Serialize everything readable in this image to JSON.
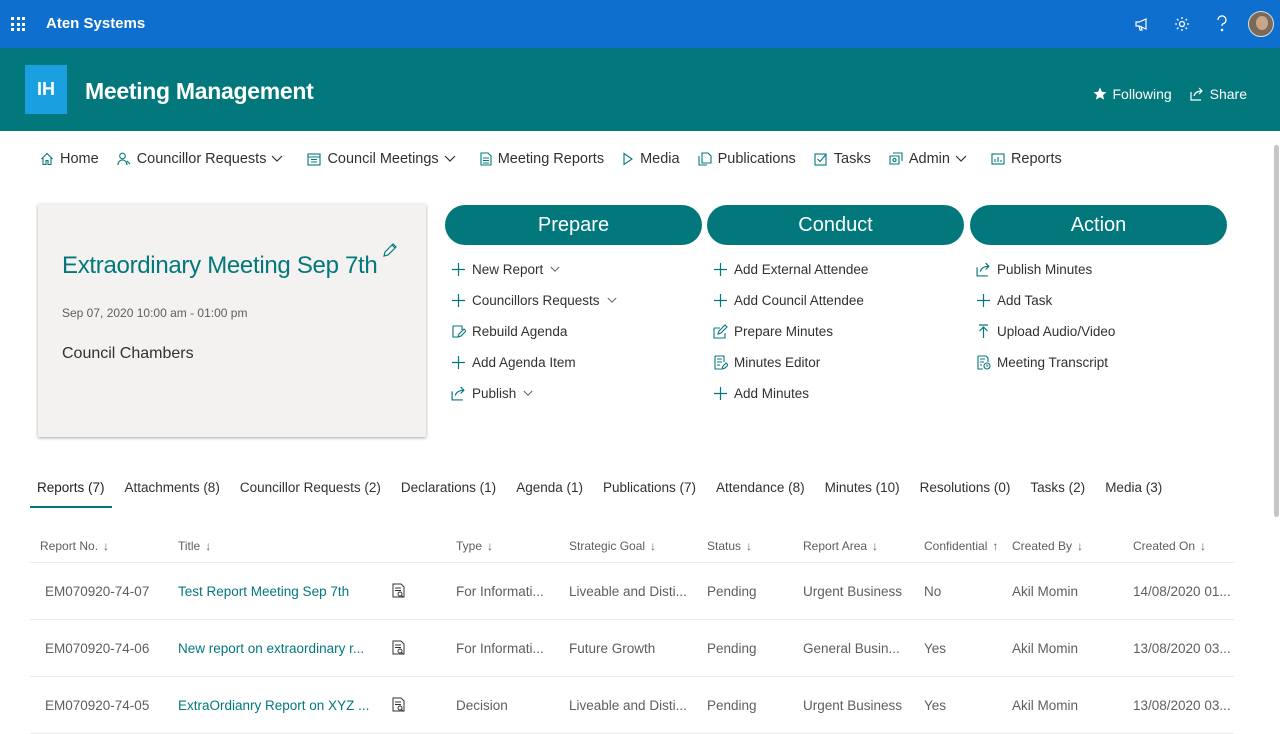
{
  "suite": {
    "org_name": "Aten Systems",
    "icons": [
      "waffle-icon",
      "megaphone-icon",
      "gear-icon",
      "help-icon",
      "avatar"
    ]
  },
  "site": {
    "logo_text": "IH",
    "title": "Meeting Management",
    "following_label": "Following",
    "share_label": "Share"
  },
  "nav": [
    {
      "label": "Home",
      "icon": "home-icon",
      "dropdown": false
    },
    {
      "label": "Councillor Requests",
      "icon": "person-icon",
      "dropdown": true
    },
    {
      "label": "Council Meetings",
      "icon": "calendar-icon",
      "dropdown": true
    },
    {
      "label": "Meeting Reports",
      "icon": "document-icon",
      "dropdown": false
    },
    {
      "label": "Media",
      "icon": "play-icon",
      "dropdown": false
    },
    {
      "label": "Publications",
      "icon": "documents-icon",
      "dropdown": false
    },
    {
      "label": "Tasks",
      "icon": "checkbox-icon",
      "dropdown": false
    },
    {
      "label": "Admin",
      "icon": "admin-icon",
      "dropdown": true
    },
    {
      "label": "Reports",
      "icon": "chart-icon",
      "dropdown": false
    }
  ],
  "meeting": {
    "title": "Extraordinary Meeting Sep 7th",
    "datetime": "Sep 07, 2020 10:00 am - 01:00 pm",
    "location": "Council Chambers"
  },
  "columns": {
    "prepare": {
      "heading": "Prepare",
      "links": [
        "New Report",
        "Councillors Requests",
        "Rebuild Agenda",
        "Add Agenda Item",
        "Publish"
      ]
    },
    "conduct": {
      "heading": "Conduct",
      "links": [
        "Add External Attendee",
        "Add Council Attendee",
        "Prepare Minutes",
        "Minutes Editor",
        "Add Minutes"
      ]
    },
    "action": {
      "heading": "Action",
      "links": [
        "Publish Minutes",
        "Add Task",
        "Upload Audio/Video",
        "Meeting Transcript"
      ]
    }
  },
  "tabs": [
    "Reports (7)",
    "Attachments (8)",
    "Councillor Requests (2)",
    "Declarations (1)",
    "Agenda (1)",
    "Publications (7)",
    "Attendance (8)",
    "Minutes (10)",
    "Resolutions (0)",
    "Tasks (2)",
    "Media (3)"
  ],
  "table": {
    "headers": [
      "Report No.",
      "Title",
      "",
      "Type",
      "Strategic Goal",
      "Status",
      "Report Area",
      "Confidential",
      "Created By",
      "Created On"
    ],
    "sort_arrows": [
      "↓",
      "↓",
      "",
      "↓",
      "↓",
      "↓",
      "↓",
      "↑",
      "↓",
      "↓"
    ],
    "rows": [
      [
        "EM070920-74-07",
        "Test Report Meeting Sep 7th",
        "",
        "For Informati...",
        "Liveable and Disti...",
        "Pending",
        "Urgent Business",
        "No",
        "Akil Momin",
        "14/08/2020 01..."
      ],
      [
        "EM070920-74-06",
        "New report on extraordinary r...",
        "",
        "For Informati...",
        "Future Growth",
        "Pending",
        "General Busin...",
        "Yes",
        "Akil Momin",
        "13/08/2020 03..."
      ],
      [
        "EM070920-74-05",
        "ExtraOrdianry Report on XYZ ...",
        "",
        "Decision",
        "Liveable and Disti...",
        "Pending",
        "Urgent Business",
        "Yes",
        "Akil Momin",
        "13/08/2020 03..."
      ]
    ]
  },
  "colors": {
    "suite_bar": "#0f6fcf",
    "theme": "#03787c",
    "logo": "#1a9fe0"
  }
}
